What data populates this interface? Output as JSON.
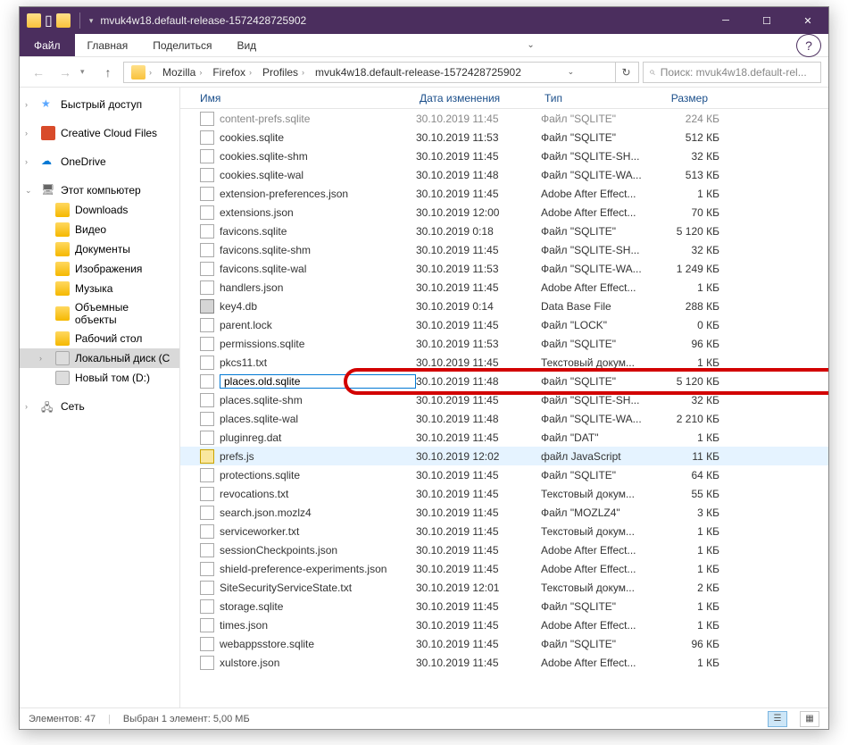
{
  "window": {
    "title": "mvuk4w18.default-release-1572428725902"
  },
  "ribbon": {
    "file": "Файл",
    "tabs": [
      "Главная",
      "Поделиться",
      "Вид"
    ]
  },
  "breadcrumbs": [
    "Mozilla",
    "Firefox",
    "Profiles",
    "mvuk4w18.default-release-1572428725902"
  ],
  "search": {
    "placeholder": "Поиск: mvuk4w18.default-rel..."
  },
  "nav": {
    "quick": "Быстрый доступ",
    "cc": "Creative Cloud Files",
    "onedrive": "OneDrive",
    "pc": "Этот компьютер",
    "pc_children": [
      "Downloads",
      "Видео",
      "Документы",
      "Изображения",
      "Музыка",
      "Объемные объекты",
      "Рабочий стол",
      "Локальный диск (C",
      "Новый том (D:)"
    ],
    "net": "Сеть"
  },
  "columns": {
    "name": "Имя",
    "date": "Дата изменения",
    "type": "Тип",
    "size": "Размер"
  },
  "files": [
    {
      "n": "content-prefs.sqlite",
      "d": "30.10.2019 11:45",
      "t": "Файл \"SQLITE\"",
      "s": "224 КБ",
      "dim": true,
      "ico": "doc"
    },
    {
      "n": "cookies.sqlite",
      "d": "30.10.2019 11:53",
      "t": "Файл \"SQLITE\"",
      "s": "512 КБ",
      "ico": "doc"
    },
    {
      "n": "cookies.sqlite-shm",
      "d": "30.10.2019 11:45",
      "t": "Файл \"SQLITE-SH...",
      "s": "32 КБ",
      "ico": "doc"
    },
    {
      "n": "cookies.sqlite-wal",
      "d": "30.10.2019 11:48",
      "t": "Файл \"SQLITE-WA...",
      "s": "513 КБ",
      "ico": "doc"
    },
    {
      "n": "extension-preferences.json",
      "d": "30.10.2019 11:45",
      "t": "Adobe After Effect...",
      "s": "1 КБ",
      "ico": "doc"
    },
    {
      "n": "extensions.json",
      "d": "30.10.2019 12:00",
      "t": "Adobe After Effect...",
      "s": "70 КБ",
      "ico": "doc"
    },
    {
      "n": "favicons.sqlite",
      "d": "30.10.2019 0:18",
      "t": "Файл \"SQLITE\"",
      "s": "5 120 КБ",
      "ico": "doc"
    },
    {
      "n": "favicons.sqlite-shm",
      "d": "30.10.2019 11:45",
      "t": "Файл \"SQLITE-SH...",
      "s": "32 КБ",
      "ico": "doc"
    },
    {
      "n": "favicons.sqlite-wal",
      "d": "30.10.2019 11:53",
      "t": "Файл \"SQLITE-WA...",
      "s": "1 249 КБ",
      "ico": "doc"
    },
    {
      "n": "handlers.json",
      "d": "30.10.2019 11:45",
      "t": "Adobe After Effect...",
      "s": "1 КБ",
      "ico": "doc"
    },
    {
      "n": "key4.db",
      "d": "30.10.2019 0:14",
      "t": "Data Base File",
      "s": "288 КБ",
      "ico": "db"
    },
    {
      "n": "parent.lock",
      "d": "30.10.2019 11:45",
      "t": "Файл \"LOCK\"",
      "s": "0 КБ",
      "ico": "doc"
    },
    {
      "n": "permissions.sqlite",
      "d": "30.10.2019 11:53",
      "t": "Файл \"SQLITE\"",
      "s": "96 КБ",
      "ico": "doc"
    },
    {
      "n": "pkcs11.txt",
      "d": "30.10.2019 11:45",
      "t": "Текстовый докум...",
      "s": "1 КБ",
      "ico": "txt"
    },
    {
      "n": "places.old.sqlite",
      "d": "30.10.2019 11:48",
      "t": "Файл \"SQLITE\"",
      "s": "5 120 КБ",
      "ico": "doc",
      "editing": true,
      "hl": true
    },
    {
      "n": "places.sqlite-shm",
      "d": "30.10.2019 11:45",
      "t": "Файл \"SQLITE-SH...",
      "s": "32 КБ",
      "ico": "doc"
    },
    {
      "n": "places.sqlite-wal",
      "d": "30.10.2019 11:48",
      "t": "Файл \"SQLITE-WA...",
      "s": "2 210 КБ",
      "ico": "doc"
    },
    {
      "n": "pluginreg.dat",
      "d": "30.10.2019 11:45",
      "t": "Файл \"DAT\"",
      "s": "1 КБ",
      "ico": "doc"
    },
    {
      "n": "prefs.js",
      "d": "30.10.2019 12:02",
      "t": "файл JavaScript",
      "s": "11 КБ",
      "ico": "js",
      "sel": true
    },
    {
      "n": "protections.sqlite",
      "d": "30.10.2019 11:45",
      "t": "Файл \"SQLITE\"",
      "s": "64 КБ",
      "ico": "doc"
    },
    {
      "n": "revocations.txt",
      "d": "30.10.2019 11:45",
      "t": "Текстовый докум...",
      "s": "55 КБ",
      "ico": "txt"
    },
    {
      "n": "search.json.mozlz4",
      "d": "30.10.2019 11:45",
      "t": "Файл \"MOZLZ4\"",
      "s": "3 КБ",
      "ico": "doc"
    },
    {
      "n": "serviceworker.txt",
      "d": "30.10.2019 11:45",
      "t": "Текстовый докум...",
      "s": "1 КБ",
      "ico": "txt"
    },
    {
      "n": "sessionCheckpoints.json",
      "d": "30.10.2019 11:45",
      "t": "Adobe After Effect...",
      "s": "1 КБ",
      "ico": "doc"
    },
    {
      "n": "shield-preference-experiments.json",
      "d": "30.10.2019 11:45",
      "t": "Adobe After Effect...",
      "s": "1 КБ",
      "ico": "doc"
    },
    {
      "n": "SiteSecurityServiceState.txt",
      "d": "30.10.2019 12:01",
      "t": "Текстовый докум...",
      "s": "2 КБ",
      "ico": "txt"
    },
    {
      "n": "storage.sqlite",
      "d": "30.10.2019 11:45",
      "t": "Файл \"SQLITE\"",
      "s": "1 КБ",
      "ico": "doc"
    },
    {
      "n": "times.json",
      "d": "30.10.2019 11:45",
      "t": "Adobe After Effect...",
      "s": "1 КБ",
      "ico": "doc"
    },
    {
      "n": "webappsstore.sqlite",
      "d": "30.10.2019 11:45",
      "t": "Файл \"SQLITE\"",
      "s": "96 КБ",
      "ico": "doc"
    },
    {
      "n": "xulstore.json",
      "d": "30.10.2019 11:45",
      "t": "Adobe After Effect...",
      "s": "1 КБ",
      "ico": "doc"
    }
  ],
  "status": {
    "count": "Элементов: 47",
    "selection": "Выбран 1 элемент: 5,00 МБ"
  }
}
